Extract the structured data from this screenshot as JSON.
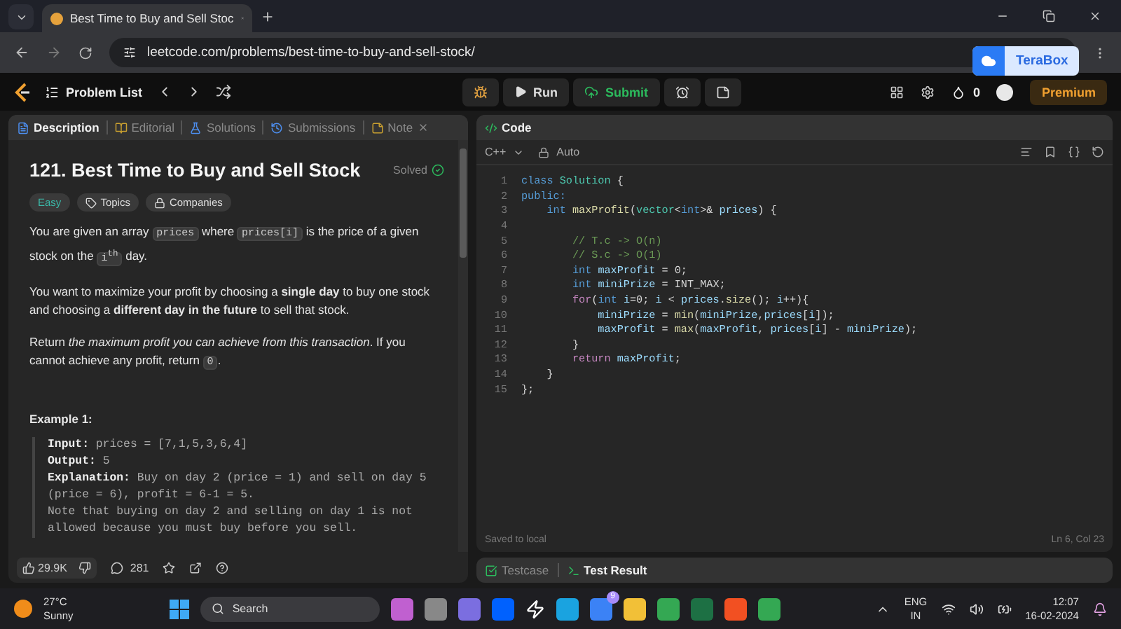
{
  "browser": {
    "tab_title": "Best Time to Buy and Sell Stoc",
    "url": "leetcode.com/problems/best-time-to-buy-and-sell-stock/"
  },
  "terabox": {
    "label": "TeraBox"
  },
  "nav": {
    "problem_list": "Problem List",
    "run": "Run",
    "submit": "Submit",
    "streak": "0",
    "premium": "Premium"
  },
  "description": {
    "tabs": [
      {
        "kind": "description",
        "label": "Description",
        "selected": true
      },
      {
        "kind": "editorial",
        "label": "Editorial",
        "selected": false
      },
      {
        "kind": "solutions",
        "label": "Solutions",
        "selected": false
      },
      {
        "kind": "submissions",
        "label": "Submissions",
        "selected": false
      },
      {
        "kind": "note",
        "label": "Note",
        "selected": false
      }
    ],
    "title": "121. Best Time to Buy and Sell Stock",
    "status": "Solved",
    "tags": [
      {
        "kind": "difficulty",
        "label": "Easy"
      },
      {
        "kind": "topics",
        "label": "Topics"
      },
      {
        "kind": "companies",
        "label": "Companies"
      }
    ],
    "paragraphs": [
      [
        {
          "kind": "text",
          "text": "You are given an array "
        },
        {
          "kind": "code",
          "text": "prices"
        },
        {
          "kind": "text",
          "text": " where "
        },
        {
          "kind": "code",
          "text": "prices[i]"
        },
        {
          "kind": "text",
          "text": " is the price of a given stock on the "
        },
        {
          "kind": "code",
          "text": "i",
          "sup": "th"
        },
        {
          "kind": "text",
          "text": " day."
        }
      ],
      [
        {
          "kind": "text",
          "text": "You want to maximize your profit by choosing a "
        },
        {
          "kind": "bold",
          "text": "single day"
        },
        {
          "kind": "text",
          "text": " to buy one stock and choosing a "
        },
        {
          "kind": "bold",
          "text": "different day in the future"
        },
        {
          "kind": "text",
          "text": " to sell that stock."
        }
      ],
      [
        {
          "kind": "text",
          "text": "Return "
        },
        {
          "kind": "italic",
          "text": "the maximum profit you can achieve from this transaction"
        },
        {
          "kind": "text",
          "text": ". If you cannot achieve any profit, return "
        },
        {
          "kind": "code",
          "text": "0"
        },
        {
          "kind": "text",
          "text": "."
        }
      ]
    ],
    "example_title": "Example 1:",
    "example_lines": [
      [
        {
          "kind": "label",
          "text": "Input:"
        },
        {
          "kind": "mono",
          "text": " prices = [7,1,5,3,6,4]"
        }
      ],
      [
        {
          "kind": "label",
          "text": "Output:"
        },
        {
          "kind": "mono",
          "text": " 5"
        }
      ],
      [
        {
          "kind": "label",
          "text": "Explanation:"
        },
        {
          "kind": "mono",
          "text": " Buy on day 2 (price = 1) and sell on day 5"
        }
      ],
      [
        {
          "kind": "mono",
          "text": "(price = 6), profit = 6-1 = 5."
        }
      ],
      [
        {
          "kind": "mono",
          "text": "Note that buying on day 2 and selling on day 1 is not"
        }
      ],
      [
        {
          "kind": "mono",
          "text": "allowed because you must buy before you sell."
        }
      ]
    ],
    "likes": "29.9K",
    "comments": "281"
  },
  "code": {
    "tab": "Code",
    "language": "C++",
    "mode": "Auto",
    "lines": [
      {
        "number": "1",
        "tokens": [
          {
            "kind": "keyword",
            "text": "class "
          },
          {
            "kind": "type",
            "text": "Solution"
          },
          {
            "kind": "plain",
            "text": " {"
          }
        ]
      },
      {
        "number": "2",
        "tokens": [
          {
            "kind": "keyword",
            "text": "public:"
          }
        ]
      },
      {
        "number": "3",
        "tokens": [
          {
            "kind": "keyword",
            "text": "    int "
          },
          {
            "kind": "function",
            "text": "maxProfit"
          },
          {
            "kind": "plain",
            "text": "("
          },
          {
            "kind": "type",
            "text": "vector"
          },
          {
            "kind": "plain",
            "text": "<"
          },
          {
            "kind": "keyword",
            "text": "int"
          },
          {
            "kind": "plain",
            "text": ">& "
          },
          {
            "kind": "variable",
            "text": "prices"
          },
          {
            "kind": "plain",
            "text": ") {"
          }
        ]
      },
      {
        "number": "4"
      },
      {
        "number": "5",
        "tokens": [
          {
            "kind": "comment",
            "text": "        // T.c -> O(n)"
          }
        ]
      },
      {
        "number": "6",
        "tokens": [
          {
            "kind": "comment",
            "text": "        // S.c -> O(1)"
          }
        ]
      },
      {
        "number": "7",
        "tokens": [
          {
            "kind": "keyword",
            "text": "        int "
          },
          {
            "kind": "variable",
            "text": "maxProfit"
          },
          {
            "kind": "plain",
            "text": " = 0;"
          }
        ]
      },
      {
        "number": "8",
        "tokens": [
          {
            "kind": "keyword",
            "text": "        int "
          },
          {
            "kind": "variable",
            "text": "miniPrize"
          },
          {
            "kind": "plain",
            "text": " = INT_MAX;"
          }
        ]
      },
      {
        "number": "9",
        "tokens": [
          {
            "kind": "control",
            "text": "        for"
          },
          {
            "kind": "plain",
            "text": "("
          },
          {
            "kind": "keyword",
            "text": "int "
          },
          {
            "kind": "variable",
            "text": "i"
          },
          {
            "kind": "plain",
            "text": "=0; "
          },
          {
            "kind": "variable",
            "text": "i"
          },
          {
            "kind": "plain",
            "text": " < "
          },
          {
            "kind": "variable",
            "text": "prices"
          },
          {
            "kind": "plain",
            "text": "."
          },
          {
            "kind": "function",
            "text": "size"
          },
          {
            "kind": "plain",
            "text": "(); "
          },
          {
            "kind": "variable",
            "text": "i"
          },
          {
            "kind": "plain",
            "text": "++){"
          }
        ]
      },
      {
        "number": "10",
        "tokens": [
          {
            "kind": "variable",
            "text": "            miniPrize"
          },
          {
            "kind": "plain",
            "text": " = "
          },
          {
            "kind": "function",
            "text": "min"
          },
          {
            "kind": "plain",
            "text": "("
          },
          {
            "kind": "variable",
            "text": "miniPrize"
          },
          {
            "kind": "plain",
            "text": ","
          },
          {
            "kind": "variable",
            "text": "prices"
          },
          {
            "kind": "plain",
            "text": "["
          },
          {
            "kind": "variable",
            "text": "i"
          },
          {
            "kind": "plain",
            "text": "]);"
          }
        ]
      },
      {
        "number": "11",
        "tokens": [
          {
            "kind": "variable",
            "text": "            maxProfit"
          },
          {
            "kind": "plain",
            "text": " = "
          },
          {
            "kind": "function",
            "text": "max"
          },
          {
            "kind": "plain",
            "text": "("
          },
          {
            "kind": "variable",
            "text": "maxProfit"
          },
          {
            "kind": "plain",
            "text": ", "
          },
          {
            "kind": "variable",
            "text": "prices"
          },
          {
            "kind": "plain",
            "text": "["
          },
          {
            "kind": "variable",
            "text": "i"
          },
          {
            "kind": "plain",
            "text": "] - "
          },
          {
            "kind": "variable",
            "text": "miniPrize"
          },
          {
            "kind": "plain",
            "text": ");"
          }
        ]
      },
      {
        "number": "12",
        "tokens": [
          {
            "kind": "plain",
            "text": "        }"
          }
        ]
      },
      {
        "number": "13",
        "tokens": [
          {
            "kind": "control",
            "text": "        return "
          },
          {
            "kind": "variable",
            "text": "maxProfit"
          },
          {
            "kind": "plain",
            "text": ";"
          }
        ]
      },
      {
        "number": "14",
        "tokens": [
          {
            "kind": "plain",
            "text": "    }"
          }
        ]
      },
      {
        "number": "15",
        "tokens": [
          {
            "kind": "plain",
            "text": "};"
          }
        ]
      }
    ],
    "status": "Saved to local",
    "cursor": "Ln 6, Col 23"
  },
  "bottom_tabs": [
    {
      "kind": "testcase",
      "label": "Testcase",
      "selected": false
    },
    {
      "kind": "result",
      "label": "Test Result",
      "selected": true
    }
  ],
  "taskbar": {
    "temperature": "27°C",
    "weather": "Sunny",
    "search": "Search",
    "mail_badge": "9",
    "language": "ENG",
    "region": "IN",
    "time": "12:07",
    "date": "16-02-2024"
  }
}
